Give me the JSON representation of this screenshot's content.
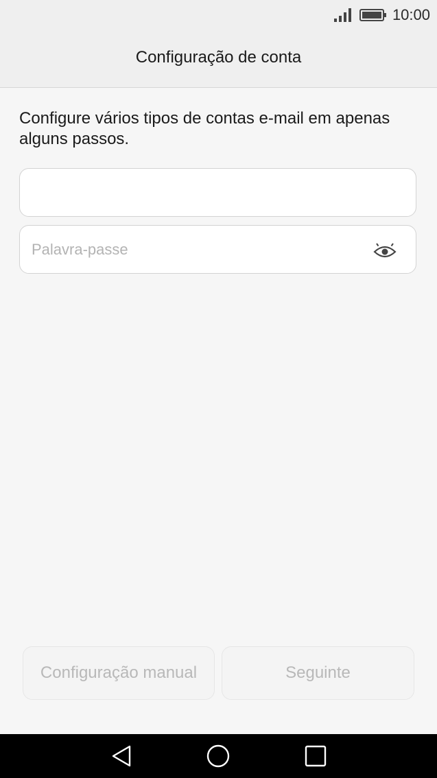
{
  "status_bar": {
    "time": "10:00",
    "icons": [
      "signal-icon",
      "battery-icon"
    ]
  },
  "header": {
    "title": "Configuração de conta"
  },
  "main": {
    "intro_text": "Configure vários tipos de contas e-mail em apenas alguns passos.",
    "email_field": {
      "value": "",
      "placeholder": ""
    },
    "password_field": {
      "value": "",
      "placeholder": "Palavra-passe",
      "icon": "eye-icon"
    }
  },
  "buttons": {
    "manual_label": "Configuração manual",
    "next_label": "Seguinte"
  },
  "nav_bar": {
    "icons": [
      "back-icon",
      "home-icon",
      "recents-icon"
    ]
  },
  "colors": {
    "background": "#f6f6f6",
    "header_background": "#efefef",
    "disabled_text": "#b8b8b8",
    "nav_background": "#000000"
  }
}
